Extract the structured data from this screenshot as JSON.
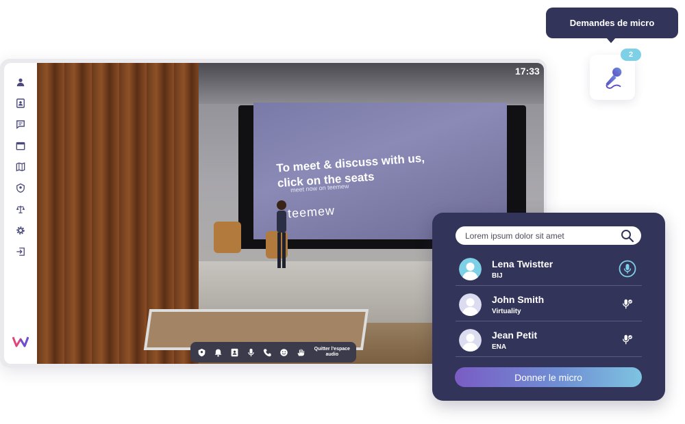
{
  "app": {
    "clock": "17:33",
    "sidebar_icons": [
      "user-icon",
      "contacts-icon",
      "chat-icon",
      "calendar-icon",
      "map-icon",
      "badge-icon",
      "balance-icon",
      "settings-icon",
      "exit-icon"
    ],
    "logo": "W"
  },
  "scene": {
    "screen_line1": "To meet & discuss with us,",
    "screen_line2": "click on the seats",
    "screen_sub": "meet now on teemew",
    "screen_brand": "teemew"
  },
  "toolbar": {
    "icons": [
      "avatar-icon",
      "bell-icon",
      "contact-card-icon",
      "microphone-icon",
      "phone-icon",
      "emoji-icon",
      "raise-hand-icon"
    ],
    "quit_label_line1": "Quitter l'espace",
    "quit_label_line2": "audio"
  },
  "mic_requests": {
    "tooltip": "Demandes de micro",
    "badge_count": "2"
  },
  "panel": {
    "search_placeholder": "Lorem ipsum dolor sit amet",
    "users": [
      {
        "name": "Lena Twistter",
        "org": "BIJ",
        "avatar_color": "#7dd0e6",
        "active": true
      },
      {
        "name": "John Smith",
        "org": "Virtuality",
        "avatar_color": "#dcdcf0",
        "active": false
      },
      {
        "name": "Jean Petit",
        "org": "ENA",
        "avatar_color": "#dcdcf0",
        "active": false
      }
    ],
    "give_button": "Donner le micro"
  },
  "colors": {
    "panel_bg": "#33345a",
    "accent_blue": "#7dd0e6",
    "sidebar_icon": "#4a4b7a"
  }
}
